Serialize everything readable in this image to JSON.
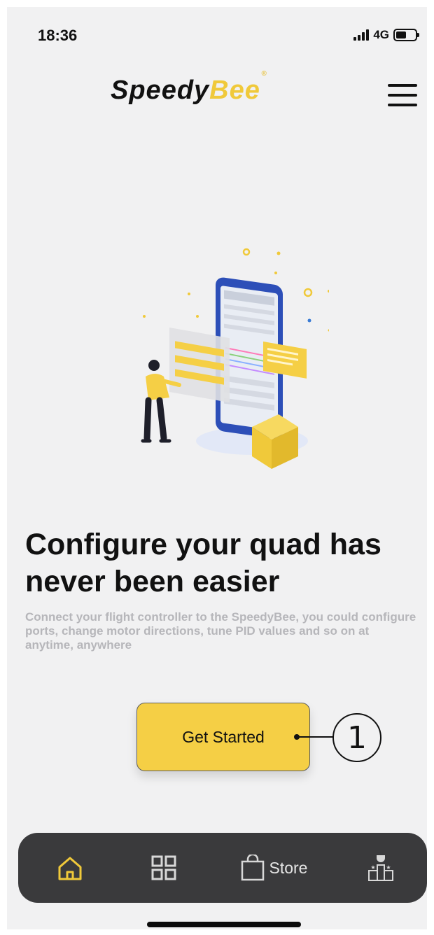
{
  "status_bar": {
    "time": "18:36",
    "network": "4G",
    "signal_icon": "cellular-signal-icon",
    "battery_icon": "battery-icon"
  },
  "header": {
    "logo_part1": "Speedy",
    "logo_part2": "Bee",
    "logo_mark": "®",
    "menu_icon": "hamburger-menu-icon"
  },
  "hero": {
    "illustration": "person-configuring-phone-illustration",
    "headline": "Configure your quad has never been easier",
    "description": "Connect your flight controller to the SpeedyBee, you could configure ports, change motor directions, tune PID values and so on at anytime, anywhere"
  },
  "actions": {
    "get_started_label": "Get Started",
    "callout_number": "1"
  },
  "tab_bar": {
    "items": [
      {
        "icon": "home-icon",
        "label": "",
        "active": true
      },
      {
        "icon": "grid-icon",
        "label": "",
        "active": false
      },
      {
        "icon": "shopping-bag-icon",
        "label": "Store",
        "active": false
      },
      {
        "icon": "leaderboard-podium-icon",
        "label": "",
        "active": false
      }
    ]
  },
  "colors": {
    "accent": "#f5cf45",
    "background": "#f1f1f2",
    "tab_bar": "#3a3a3c",
    "active_tab_icon": "#f0c93a",
    "text_primary": "#111111",
    "text_secondary": "#b6b6ba"
  }
}
